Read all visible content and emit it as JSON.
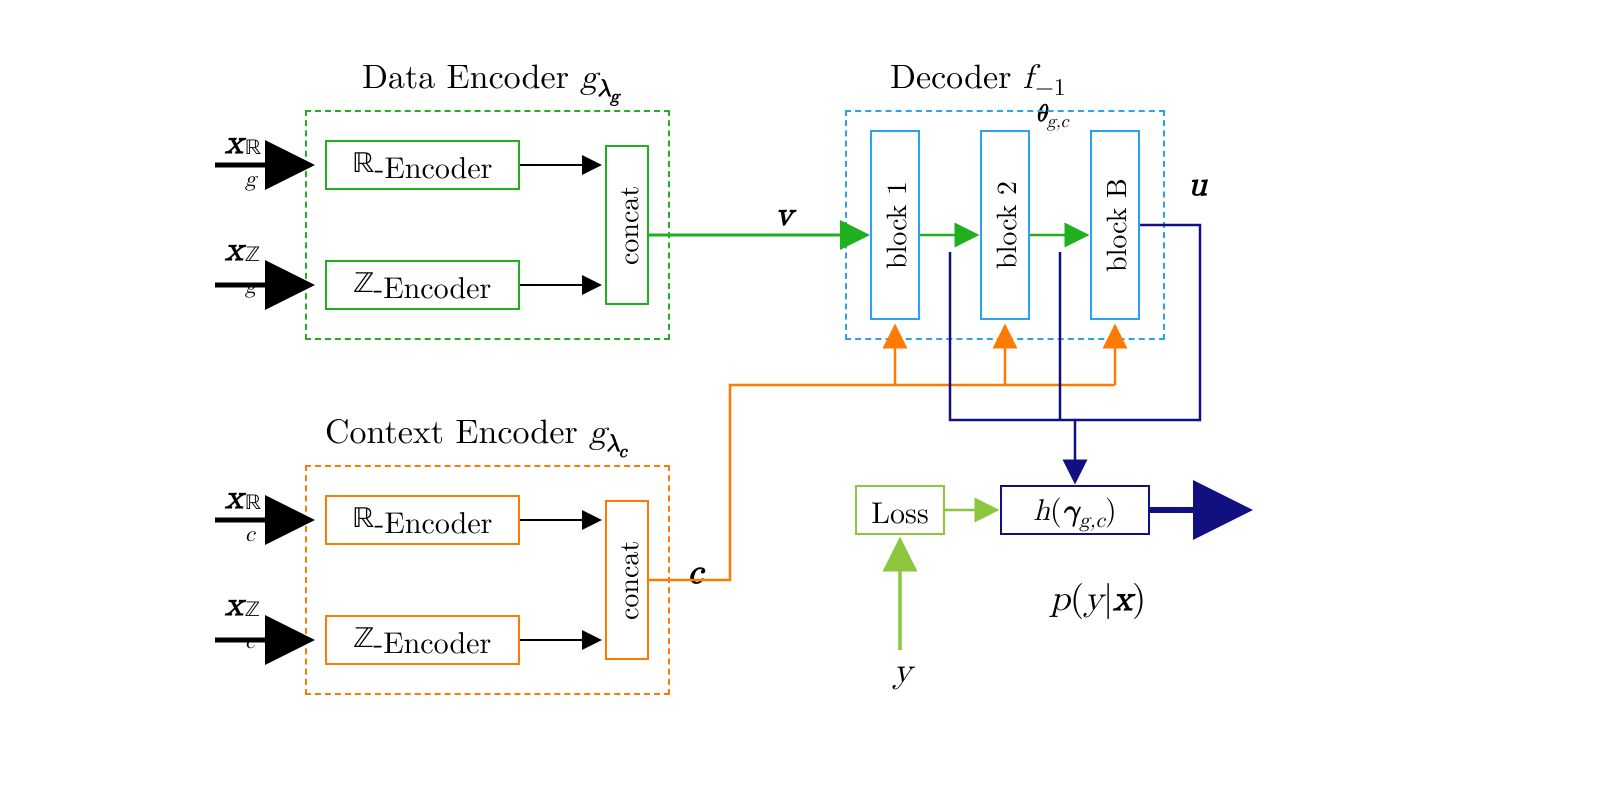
{
  "colors": {
    "green": "#1FAF1F",
    "orange": "#FF7A00",
    "lightblue": "#29A3F0",
    "navy": "#101080",
    "lime": "#8CC63F",
    "black": "#000000"
  },
  "titles": {
    "data_encoder": "Data Encoder ",
    "data_encoder_fn": "g",
    "data_encoder_sub": "λ_g",
    "context_encoder": "Context Encoder ",
    "context_encoder_fn": "g",
    "context_encoder_sub": "λ_c",
    "decoder": "Decoder ",
    "decoder_fn": "f",
    "decoder_sup": "−1",
    "decoder_sub": "θ_{g,c}"
  },
  "inputs": {
    "xg_R_base": "x",
    "xg_R_sub": "g",
    "xg_R_sup": "ℝ",
    "xg_Z_base": "x",
    "xg_Z_sub": "g",
    "xg_Z_sup": "ℤ",
    "xc_R_base": "x",
    "xc_R_sub": "c",
    "xc_R_sup": "ℝ",
    "xc_Z_base": "x",
    "xc_Z_sub": "c",
    "xc_Z_sup": "ℤ"
  },
  "inner_boxes": {
    "r_encoder": "ℝ-Encoder",
    "z_encoder": "ℤ-Encoder",
    "concat": "concat"
  },
  "mid_labels": {
    "v": "v",
    "c": "c",
    "u": "u"
  },
  "decoder_blocks": {
    "block1": "block 1",
    "block2": "block 2",
    "blockB": "block B"
  },
  "bottom": {
    "loss": "Loss",
    "h_fn": "h(γ_{g,c})",
    "y": "y",
    "pyx": "p(y|x)"
  }
}
